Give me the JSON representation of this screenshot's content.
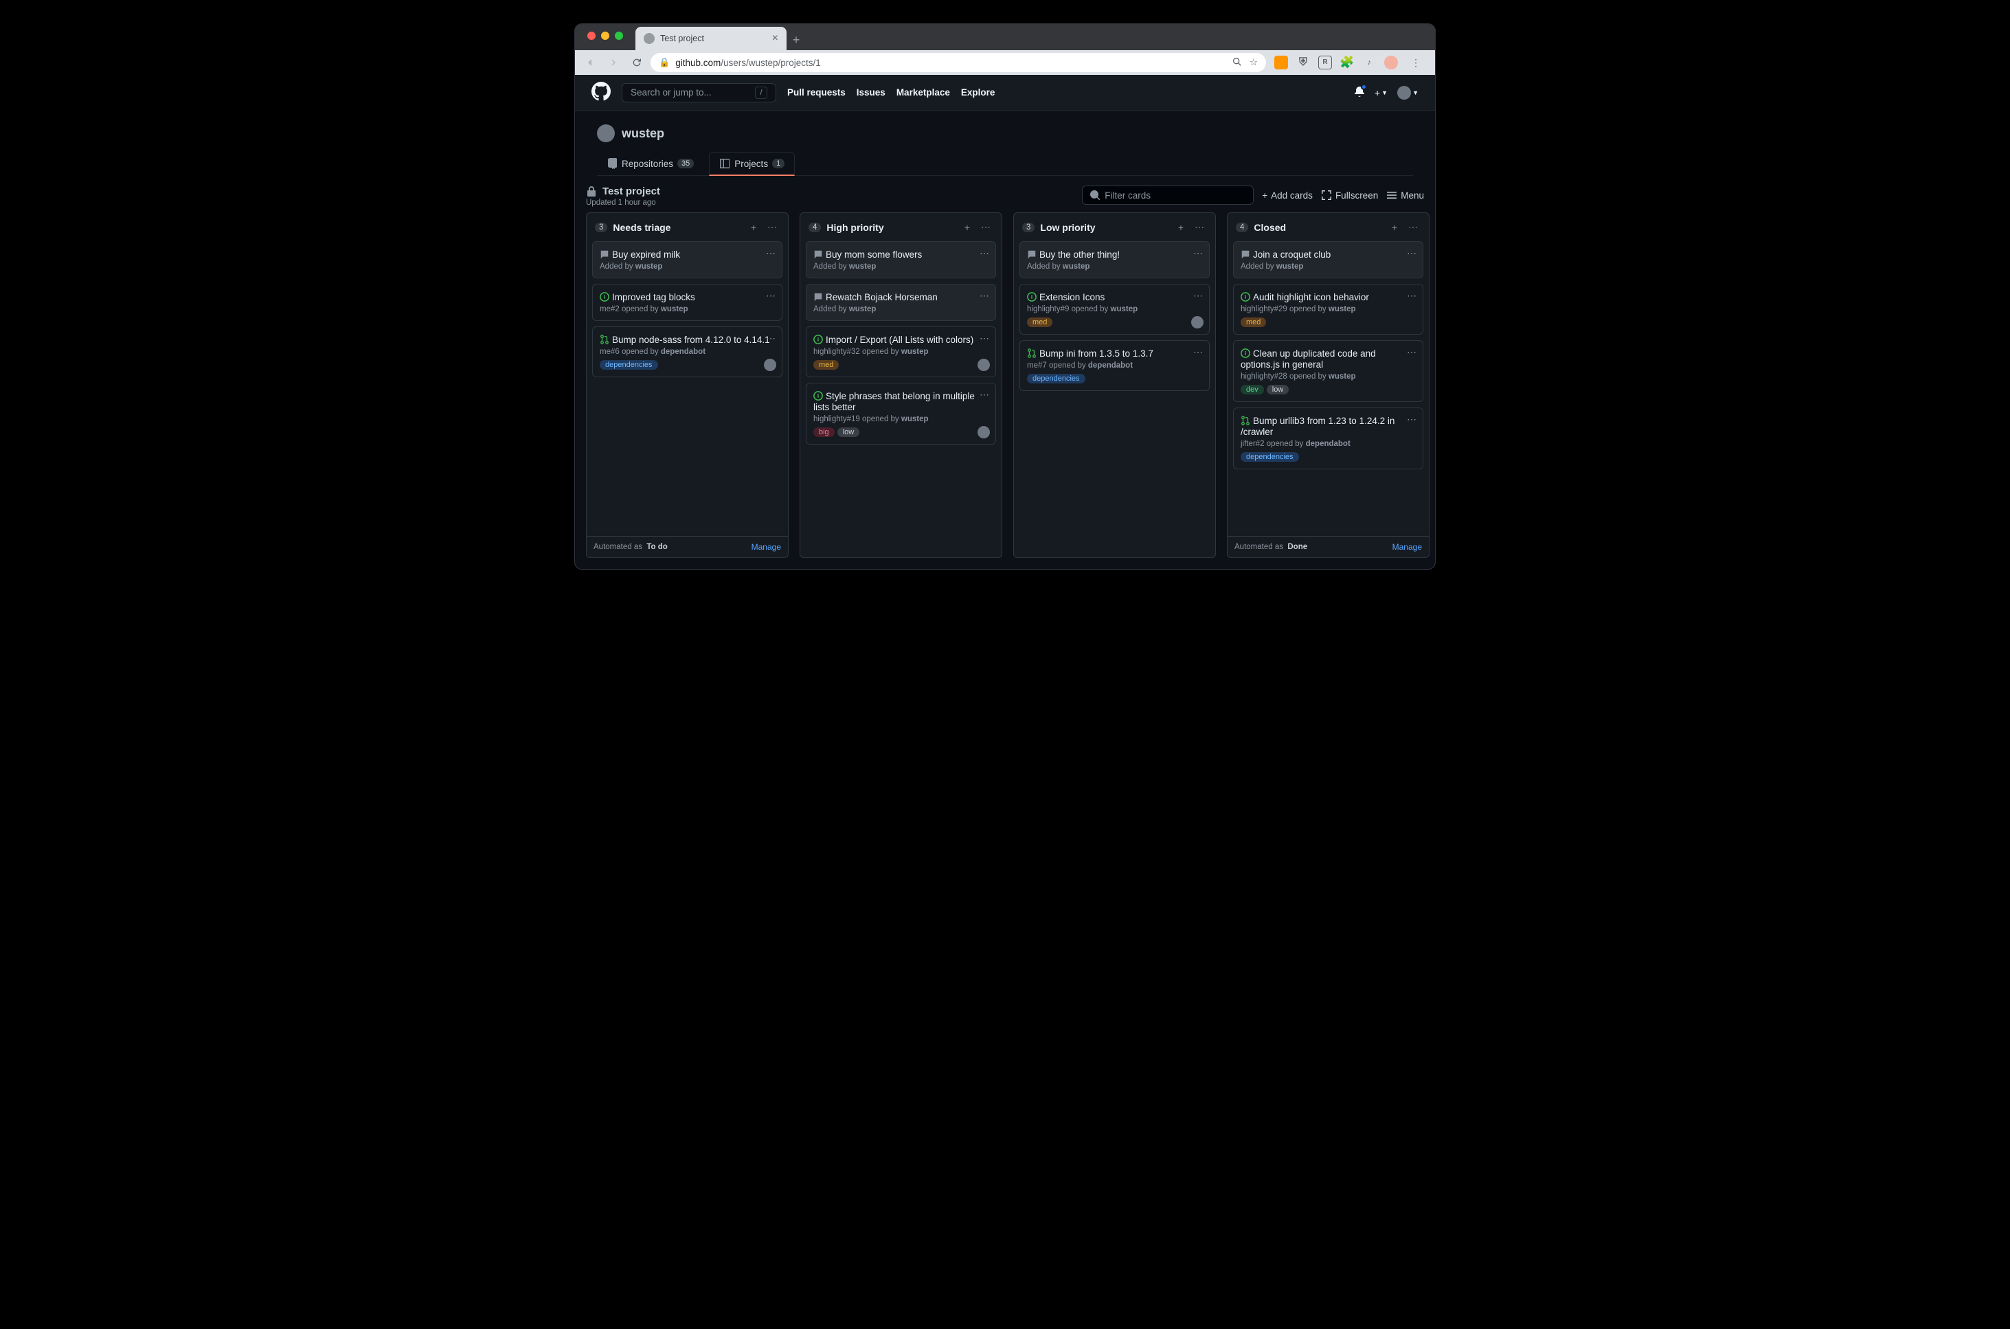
{
  "browser": {
    "tab_title": "Test project",
    "url_domain": "github.com",
    "url_path": "/users/wustep/projects/1"
  },
  "header": {
    "search_placeholder": "Search or jump to...",
    "slash": "/",
    "nav": [
      "Pull requests",
      "Issues",
      "Marketplace",
      "Explore"
    ]
  },
  "profile": {
    "username": "wustep",
    "tabs": [
      {
        "icon": "repo",
        "label": "Repositories",
        "count": "35",
        "active": false
      },
      {
        "icon": "project",
        "label": "Projects",
        "count": "1",
        "active": true
      }
    ]
  },
  "project": {
    "title": "Test project",
    "updated": "Updated 1 hour ago",
    "filter_placeholder": "Filter cards",
    "add_cards": "Add cards",
    "fullscreen": "Fullscreen",
    "menu": "Menu"
  },
  "label_colors": {
    "dependencies": {
      "bg": "#1e3a5f",
      "fg": "#6cb6ff"
    },
    "med": {
      "bg": "#5a3d1e",
      "fg": "#e3b341"
    },
    "big": {
      "bg": "#4a1f2a",
      "fg": "#f57a9d"
    },
    "low": {
      "bg": "#3a3f47",
      "fg": "#c9d1d9"
    },
    "dev": {
      "bg": "#1c3f32",
      "fg": "#57d78c"
    }
  },
  "columns": [
    {
      "count": "3",
      "title": "Needs triage",
      "cards": [
        {
          "type": "note",
          "title": "Buy expired milk",
          "meta_prefix": "Added by ",
          "author": "wustep"
        },
        {
          "type": "issue",
          "title": "Improved tag blocks",
          "ref": "me#2",
          "meta_mid": " opened by ",
          "author": "wustep"
        },
        {
          "type": "pr",
          "title": "Bump node-sass from 4.12.0 to 4.14.1",
          "ref": "me#6",
          "meta_mid": " opened by ",
          "author": "dependabot",
          "labels": [
            "dependencies"
          ],
          "avatar": true
        }
      ],
      "footer": {
        "automated_as": "Automated as",
        "status": "To do",
        "manage": "Manage"
      }
    },
    {
      "count": "4",
      "title": "High priority",
      "cards": [
        {
          "type": "note",
          "title": "Buy mom some flowers",
          "meta_prefix": "Added by ",
          "author": "wustep"
        },
        {
          "type": "note",
          "title": "Rewatch Bojack Horseman",
          "meta_prefix": "Added by ",
          "author": "wustep"
        },
        {
          "type": "issue",
          "title": "Import / Export (All Lists with colors)",
          "ref": "highlighty#32",
          "meta_mid": " opened by ",
          "author": "wustep",
          "labels": [
            "med"
          ],
          "avatar": true
        },
        {
          "type": "issue",
          "title": "Style phrases that belong in multiple lists better",
          "ref": "highlighty#19",
          "meta_mid": " opened by ",
          "author": "wustep",
          "labels": [
            "big",
            "low"
          ],
          "avatar": true
        }
      ]
    },
    {
      "count": "3",
      "title": "Low priority",
      "cards": [
        {
          "type": "note",
          "title": "Buy the other thing!",
          "meta_prefix": "Added by ",
          "author": "wustep"
        },
        {
          "type": "issue",
          "title": "Extension Icons",
          "ref": "highlighty#9",
          "meta_mid": " opened by ",
          "author": "wustep",
          "labels": [
            "med"
          ],
          "avatar": true
        },
        {
          "type": "pr",
          "title": "Bump ini from 1.3.5 to 1.3.7",
          "ref": "me#7",
          "meta_mid": " opened by ",
          "author": "dependabot",
          "labels": [
            "dependencies"
          ]
        }
      ]
    },
    {
      "count": "4",
      "title": "Closed",
      "cards": [
        {
          "type": "note",
          "title": "Join a croquet club",
          "meta_prefix": "Added by ",
          "author": "wustep"
        },
        {
          "type": "issue",
          "title": "Audit highlight icon behavior",
          "ref": "highlighty#29",
          "meta_mid": " opened by ",
          "author": "wustep",
          "labels": [
            "med"
          ]
        },
        {
          "type": "issue",
          "title": "Clean up duplicated code and options.js in general",
          "ref": "highlighty#28",
          "meta_mid": " opened by ",
          "author": "wustep",
          "labels": [
            "dev",
            "low"
          ]
        },
        {
          "type": "pr",
          "title": "Bump urllib3 from 1.23 to 1.24.2 in /crawler",
          "ref": "jifter#2",
          "meta_mid": " opened by ",
          "author": "dependabot",
          "labels": [
            "dependencies"
          ]
        }
      ],
      "footer": {
        "automated_as": "Automated as",
        "status": "Done",
        "manage": "Manage"
      }
    }
  ]
}
